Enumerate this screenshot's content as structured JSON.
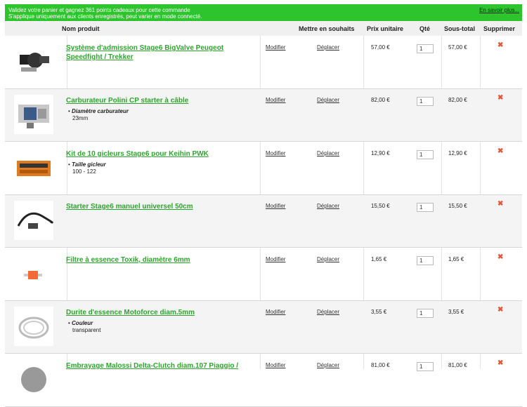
{
  "banner": {
    "line1": "Validez votre panier et gagnez 361 points cadeaux pour cette commande",
    "line2": "S'applique uniquement aux clients enregistrés, peut varier en mode connecté.",
    "more": "En savoir plus..."
  },
  "header": {
    "product": "Nom produit",
    "wishlist": "Mettre en souhaits",
    "unit_price": "Prix unitaire",
    "qty": "Qté",
    "subtotal": "Sous-total",
    "remove": "Supprimer"
  },
  "actions": {
    "modify": "Modifier",
    "move": "Déplacer",
    "remove_icon": "x-icon"
  },
  "colors": {
    "banner": "#2ec42e",
    "product_link": "#2ea42e",
    "remove": "#e05a3a"
  },
  "items": [
    {
      "name": "Système d'admission Stage6 BigValve Peugeot Speedfight / Trekker",
      "option_label": "",
      "option_value": "",
      "price": "57,00 €",
      "qty": "1",
      "subtotal": "57,00 €",
      "icon": "intake-icon"
    },
    {
      "name": "Carburateur Polini CP starter à câble",
      "option_label": "Diamètre carburateur",
      "option_value": "23mm",
      "price": "82,00 €",
      "qty": "1",
      "subtotal": "82,00 €",
      "icon": "carburetor-icon"
    },
    {
      "name": "Kit de 10 gicleurs Stage6 pour Keihin PWK",
      "option_label": "Taille gicleur",
      "option_value": "100 - 122",
      "price": "12,90 €",
      "qty": "1",
      "subtotal": "12,90 €",
      "icon": "jet-kit-icon"
    },
    {
      "name": "Starter Stage6 manuel universel 50cm",
      "option_label": "",
      "option_value": "",
      "price": "15,50 €",
      "qty": "1",
      "subtotal": "15,50 €",
      "icon": "cable-icon"
    },
    {
      "name": "Filtre à essence Toxik, diamètre 6mm",
      "option_label": "",
      "option_value": "",
      "price": "1,65 €",
      "qty": "1",
      "subtotal": "1,65 €",
      "icon": "fuel-filter-icon"
    },
    {
      "name": "Durite d'essence Motoforce diam.5mm",
      "option_label": "Couleur",
      "option_value": "transparent",
      "price": "3,55 €",
      "qty": "1",
      "subtotal": "3,55 €",
      "icon": "fuel-hose-icon"
    },
    {
      "name": "Embrayage Malossi Delta-Clutch diam.107 Piaggio /",
      "option_label": "",
      "option_value": "",
      "price": "81,00 €",
      "qty": "1",
      "subtotal": "81,00 €",
      "icon": "clutch-icon"
    }
  ]
}
